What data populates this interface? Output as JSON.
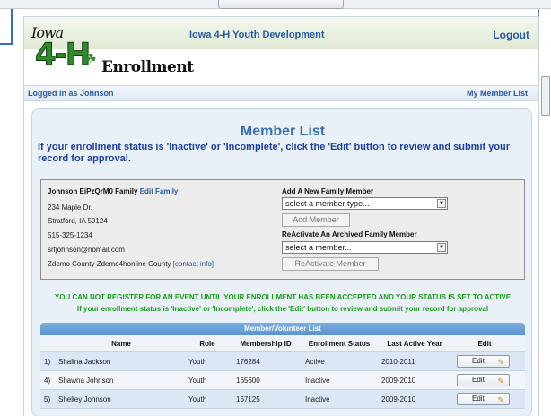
{
  "header": {
    "org_title": "Iowa 4-H Youth Development",
    "logout_label": "Logout",
    "logo": {
      "iowa": "Iowa",
      "fourh": "4-H",
      "enrollment": "Enrollment"
    }
  },
  "userbar": {
    "logged_in": "Logged in as Johnson",
    "my_member_list": "My Member List"
  },
  "main": {
    "title": "Member List",
    "notice": "If your enrollment status is 'Inactive' or 'Incomplete', click the 'Edit' button to review and submit your record for approval."
  },
  "family": {
    "name": "Johnson EiPzQrM0 Family",
    "edit_family": "Edit Family",
    "address1": "234 Maple Dr.",
    "address2": "Stratford, IA 50124",
    "phone": "515-325-1234",
    "email": "srfjohnson@nomail.com",
    "county": "Zdemo County Zdemo4honline County",
    "contact_info": "[contact info]"
  },
  "add_member": {
    "label": "Add A New Family Member",
    "select_value": "select a member type...",
    "button": "Add Member"
  },
  "reactivate": {
    "label": "ReActivate An Archived Family Member",
    "select_value": "select a member...",
    "button": "ReActivate Member"
  },
  "warnings": {
    "line1": "YOU CAN NOT REGISTER FOR AN EVENT UNTIL YOUR ENROLLMENT HAS BEEN ACCEPTED AND YOUR STATUS IS SET TO ACTIVE",
    "line2": "If your enrollment status is 'Inactive' or 'Incomplete', click the 'Edit' button to review and submit your record for approval"
  },
  "table": {
    "title": "Member/Volunteer List",
    "columns": [
      "Name",
      "Role",
      "Membership ID",
      "Enrollment Status",
      "Last Active Year",
      "Edit"
    ],
    "edit_label": "Edit",
    "rows": [
      {
        "index": "1)",
        "name": "Shalina Jackson",
        "role": "Youth",
        "id": "176284",
        "status": "Active",
        "year": "2010-2011"
      },
      {
        "index": "4)",
        "name": "Shawna Johnson",
        "role": "Youth",
        "id": "165600",
        "status": "Inactive",
        "year": "2009-2010"
      },
      {
        "index": "5)",
        "name": "Shelley Johnson",
        "role": "Youth",
        "id": "167125",
        "status": "Inactive",
        "year": "2009-2010"
      }
    ]
  },
  "colors": {
    "brand_blue": "#2a5aa0",
    "title_blue": "#3a6fb0",
    "notice_blue": "#1b3fa0",
    "warning_green": "#1a9a1a",
    "logo_green": "#2f8a2a"
  }
}
